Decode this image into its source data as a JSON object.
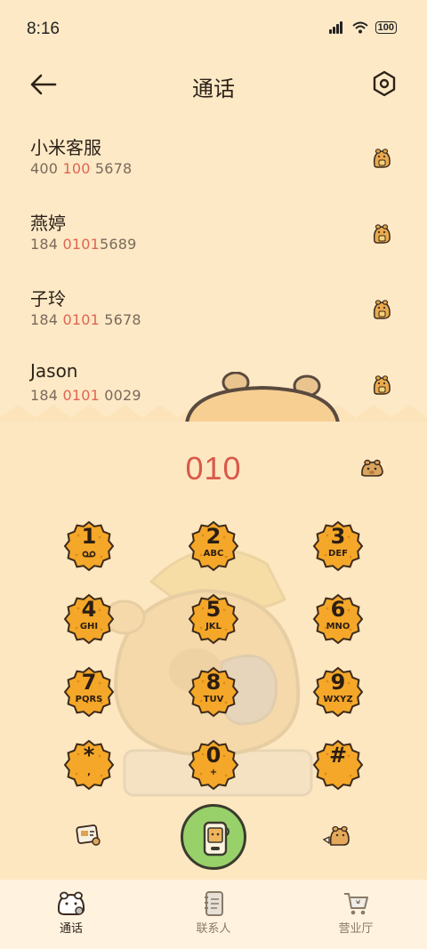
{
  "status_bar": {
    "time": "8:16",
    "battery": "100"
  },
  "header": {
    "title": "通话"
  },
  "contacts": [
    {
      "name": "小米客服",
      "number_parts": [
        "400 ",
        "100",
        " 5678"
      ]
    },
    {
      "name": "燕婷",
      "number_parts": [
        "184 ",
        "0101",
        "5689"
      ]
    },
    {
      "name": "子玲",
      "number_parts": [
        "184 ",
        "0101",
        " 5678"
      ]
    },
    {
      "name": "Jason",
      "number_parts": [
        "184 ",
        "0101",
        " 0029"
      ]
    }
  ],
  "dialer": {
    "input": "010",
    "keys": [
      {
        "digit": "1",
        "letters": ""
      },
      {
        "digit": "2",
        "letters": "ABC"
      },
      {
        "digit": "3",
        "letters": "DEF"
      },
      {
        "digit": "4",
        "letters": "GHI"
      },
      {
        "digit": "5",
        "letters": "JKL"
      },
      {
        "digit": "6",
        "letters": "MNO"
      },
      {
        "digit": "7",
        "letters": "PQRS"
      },
      {
        "digit": "8",
        "letters": "TUV"
      },
      {
        "digit": "9",
        "letters": "WXYZ"
      },
      {
        "digit": "*",
        "letters": ","
      },
      {
        "digit": "0",
        "letters": "+"
      },
      {
        "digit": "#",
        "letters": ""
      }
    ]
  },
  "bottom_nav": [
    {
      "label": "通话",
      "icon": "phone-bear-icon",
      "active": true
    },
    {
      "label": "联系人",
      "icon": "contacts-book-icon",
      "active": false
    },
    {
      "label": "营业厅",
      "icon": "shop-cart-icon",
      "active": false
    }
  ],
  "colors": {
    "accent": "#e06452",
    "background": "#fde9c6",
    "call_button": "#98d16a",
    "cookie": "#f5a623"
  }
}
